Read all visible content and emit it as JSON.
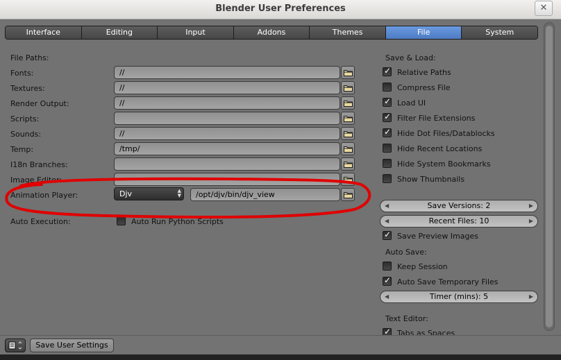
{
  "window": {
    "title": "Blender User Preferences",
    "close_label": "✕"
  },
  "tabs": [
    {
      "label": "Interface"
    },
    {
      "label": "Editing"
    },
    {
      "label": "Input"
    },
    {
      "label": "Addons"
    },
    {
      "label": "Themes"
    },
    {
      "label": "File",
      "active": true
    },
    {
      "label": "System"
    }
  ],
  "file_paths": {
    "heading": "File Paths:",
    "fonts": {
      "label": "Fonts:",
      "value": "//"
    },
    "textures": {
      "label": "Textures:",
      "value": "//"
    },
    "render_output": {
      "label": "Render Output:",
      "value": "//"
    },
    "scripts": {
      "label": "Scripts:",
      "value": ""
    },
    "sounds": {
      "label": "Sounds:",
      "value": "//"
    },
    "temp": {
      "label": "Temp:",
      "value": "/tmp/"
    },
    "i18n": {
      "label": "I18n Branches:",
      "value": ""
    },
    "image_editor": {
      "label": "Image Editor:",
      "value": ""
    },
    "animation_player": {
      "label": "Animation Player:",
      "preset": "Djv",
      "value": "/opt/djv/bin/djv_view"
    }
  },
  "auto_execution": {
    "label": "Auto Execution:",
    "run_python": {
      "label": "Auto Run Python Scripts",
      "checked": false
    }
  },
  "save_load": {
    "heading": "Save & Load:",
    "relative_paths": {
      "label": "Relative Paths",
      "checked": true
    },
    "compress_file": {
      "label": "Compress File",
      "checked": false
    },
    "load_ui": {
      "label": "Load UI",
      "checked": true
    },
    "filter_ext": {
      "label": "Filter File Extensions",
      "checked": true
    },
    "hide_dot": {
      "label": "Hide Dot Files/Datablocks",
      "checked": true
    },
    "hide_recent": {
      "label": "Hide Recent Locations",
      "checked": false
    },
    "hide_bookmarks": {
      "label": "Hide System Bookmarks",
      "checked": false
    },
    "show_thumbs": {
      "label": "Show Thumbnails",
      "checked": false
    },
    "save_versions": "Save Versions: 2",
    "recent_files": "Recent Files: 10",
    "save_preview": {
      "label": "Save Preview Images",
      "checked": true
    }
  },
  "auto_save": {
    "heading": "Auto Save:",
    "keep_session": {
      "label": "Keep Session",
      "checked": false
    },
    "auto_temp": {
      "label": "Auto Save Temporary Files",
      "checked": true
    },
    "timer": "Timer (mins): 5"
  },
  "text_editor": {
    "heading": "Text Editor:",
    "tabs_as_spaces": {
      "label": "Tabs as Spaces",
      "checked": true
    }
  },
  "bottom": {
    "save_button": "Save User Settings"
  },
  "colors": {
    "panel_bg": "#727272",
    "active_tab": "#5a8ad4",
    "annotation": "#e00000"
  }
}
